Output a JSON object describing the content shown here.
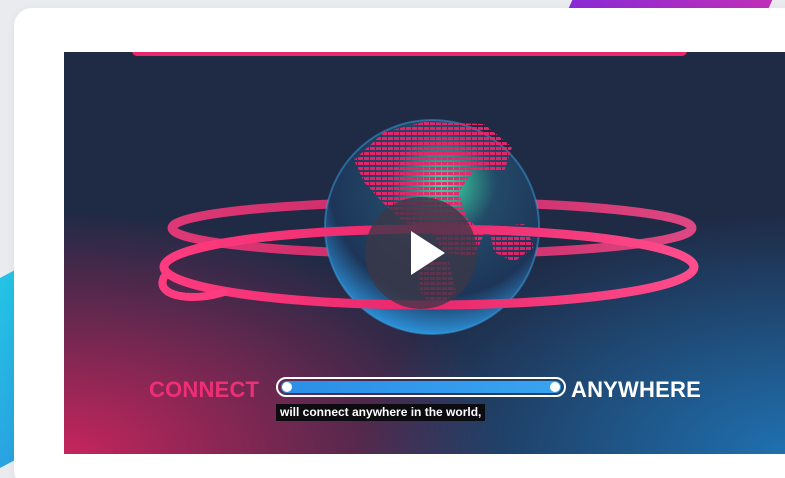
{
  "video": {
    "headline_left": "CONNECT",
    "headline_right": "ANYWHERE",
    "caption": "will connect anywhere in the world,",
    "play_icon": "play-icon"
  },
  "colors": {
    "card_background": "#ffffff",
    "video_background": "#1f2a45",
    "accent_pink": "#ee2f75",
    "accent_blue": "#2a8fe6",
    "globe_green": "#34d399"
  }
}
